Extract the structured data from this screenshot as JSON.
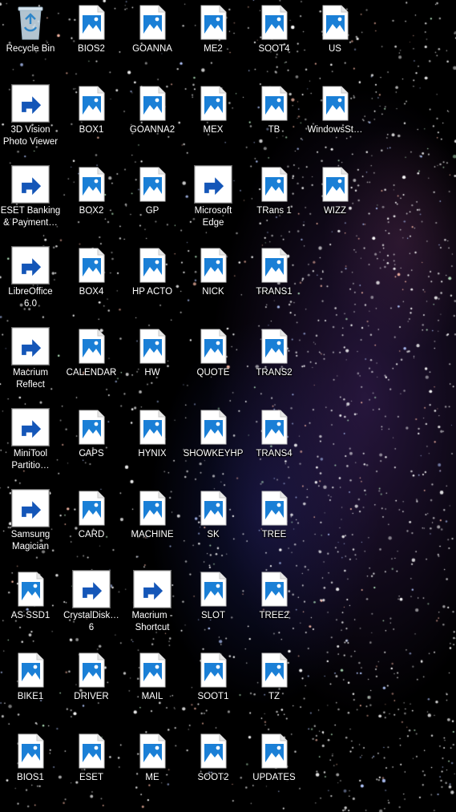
{
  "desktop": {
    "columns": [
      [
        {
          "label": "Recycle Bin",
          "icon": "recycle-bin-icon"
        },
        {
          "label": "3D Vision\nPhoto Viewer",
          "icon": "3d-vision-icon",
          "shortcut": true
        },
        {
          "label": "ESET Banking\n& Payment…",
          "icon": "eset-icon",
          "shortcut": true
        },
        {
          "label": "LibreOffice\n6.0",
          "icon": "libreoffice-icon",
          "shortcut": true
        },
        {
          "label": "Macrium\nReflect",
          "icon": "macrium-reflect-icon",
          "shortcut": true
        },
        {
          "label": "MiniTool\nPartitio…",
          "icon": "minitool-icon",
          "shortcut": true
        },
        {
          "label": "Samsung\nMagician",
          "icon": "samsung-magician-icon",
          "shortcut": true
        },
        {
          "label": "AS SSD1",
          "icon": "image-file-icon"
        },
        {
          "label": "BIKE1",
          "icon": "image-file-icon"
        },
        {
          "label": "BIOS1",
          "icon": "image-file-icon"
        }
      ],
      [
        {
          "label": "BIOS2",
          "icon": "image-file-icon"
        },
        {
          "label": "BOX1",
          "icon": "image-file-icon"
        },
        {
          "label": "BOX2",
          "icon": "image-file-icon"
        },
        {
          "label": "BOX4",
          "icon": "image-file-icon"
        },
        {
          "label": "CALENDAR",
          "icon": "image-file-icon"
        },
        {
          "label": "CAPS",
          "icon": "image-file-icon"
        },
        {
          "label": "CARD",
          "icon": "image-file-icon"
        },
        {
          "label": "CrystalDisk…\n6",
          "icon": "crystaldisk-icon",
          "shortcut": true
        },
        {
          "label": "DRIVER",
          "icon": "image-file-icon"
        },
        {
          "label": "ESET",
          "icon": "image-file-icon"
        }
      ],
      [
        {
          "label": "GOANNA",
          "icon": "image-file-icon"
        },
        {
          "label": "GOANNA2",
          "icon": "image-file-icon"
        },
        {
          "label": "GP",
          "icon": "image-file-icon"
        },
        {
          "label": "HP ACTO",
          "icon": "image-file-icon"
        },
        {
          "label": "HW",
          "icon": "image-file-icon"
        },
        {
          "label": "HYNIX",
          "icon": "image-file-icon"
        },
        {
          "label": "MACHINE",
          "icon": "image-file-icon"
        },
        {
          "label": "Macrium -\nShortcut",
          "icon": "folder-icon",
          "shortcut": true
        },
        {
          "label": "MAIL",
          "icon": "image-file-icon"
        },
        {
          "label": "ME",
          "icon": "image-file-icon"
        }
      ],
      [
        {
          "label": "ME2",
          "icon": "image-file-icon"
        },
        {
          "label": "MEX",
          "icon": "image-file-icon"
        },
        {
          "label": "Microsoft\nEdge",
          "icon": "edge-icon",
          "shortcut": true
        },
        {
          "label": "NICK",
          "icon": "image-file-icon"
        },
        {
          "label": "QUOTE",
          "icon": "image-file-icon"
        },
        {
          "label": "SHOWKEYHP",
          "icon": "image-file-icon"
        },
        {
          "label": "SK",
          "icon": "image-file-icon"
        },
        {
          "label": "SLOT",
          "icon": "image-file-icon"
        },
        {
          "label": "SOOT1",
          "icon": "image-file-icon"
        },
        {
          "label": "SOOT2",
          "icon": "image-file-icon"
        }
      ],
      [
        {
          "label": "SOOT4",
          "icon": "image-file-icon"
        },
        {
          "label": "TB",
          "icon": "image-file-icon"
        },
        {
          "label": "TRans 1",
          "icon": "image-file-icon"
        },
        {
          "label": "TRANS1",
          "icon": "image-file-icon"
        },
        {
          "label": "TRANS2",
          "icon": "image-file-icon"
        },
        {
          "label": "TRANS4",
          "icon": "image-file-icon"
        },
        {
          "label": "TREE",
          "icon": "image-file-icon"
        },
        {
          "label": "TREE2",
          "icon": "image-file-icon"
        },
        {
          "label": "TZ",
          "icon": "image-file-icon"
        },
        {
          "label": "UPDATES",
          "icon": "image-file-icon"
        }
      ],
      [
        {
          "label": "US",
          "icon": "image-file-icon"
        },
        {
          "label": "WindowsSt…",
          "icon": "image-file-icon"
        },
        {
          "label": "WIZZ",
          "icon": "image-file-icon"
        }
      ]
    ]
  },
  "colors": {
    "background": "#000000",
    "file_accent": "#1a7fd6",
    "label_text": "#ffffff"
  }
}
